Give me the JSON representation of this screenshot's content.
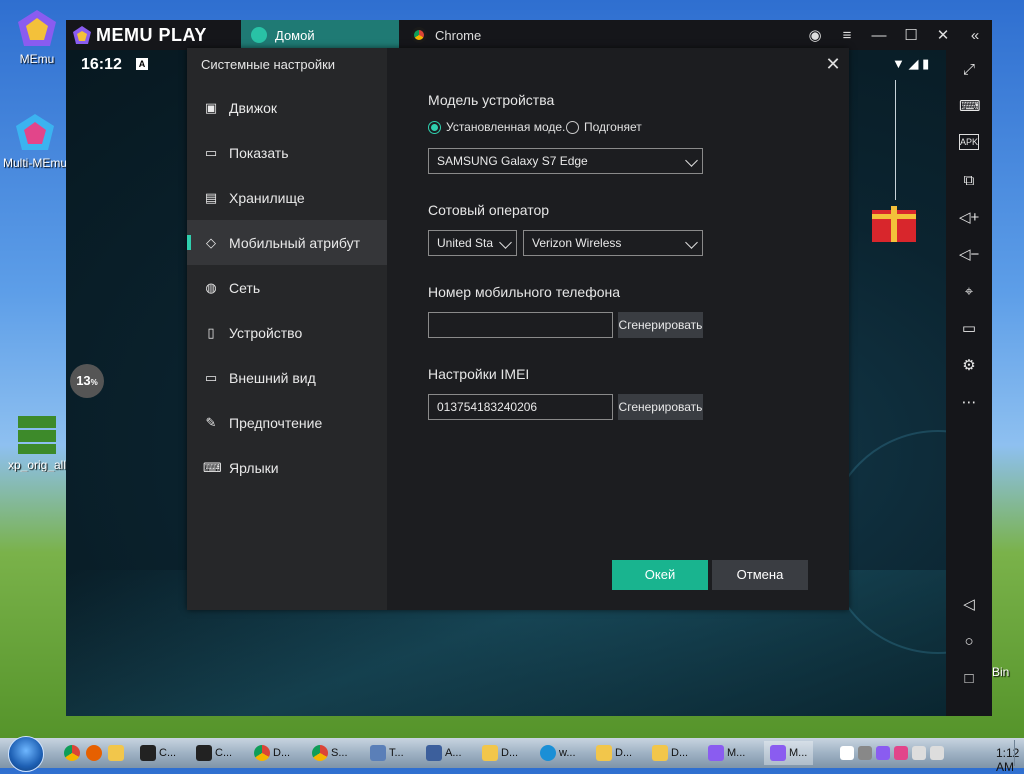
{
  "desktop": {
    "icons": [
      {
        "label": "MEmu"
      },
      {
        "label": "Multi-MEmu"
      },
      {
        "label": "xp_orig_all"
      }
    ],
    "right_label": "Bin"
  },
  "memu": {
    "logo": "MEMU PLAY",
    "tabs": [
      {
        "label": "Домой",
        "active": true
      },
      {
        "label": "Chrome",
        "active": false
      }
    ],
    "window_controls": [
      "account-icon",
      "menu-icon",
      "minimize-icon",
      "maximize-icon",
      "close-icon",
      "collapse-icon"
    ],
    "status_time": "16:12",
    "status_badge": "A",
    "progress_percent": "13",
    "progress_unit": "%"
  },
  "dialog": {
    "title": "Системные настройки",
    "menu": [
      {
        "label": "Движок",
        "icon": "chip-icon"
      },
      {
        "label": "Показать",
        "icon": "monitor-icon"
      },
      {
        "label": "Хранилище",
        "icon": "save-icon"
      },
      {
        "label": "Мобильный атрибут",
        "icon": "tag-icon",
        "active": true
      },
      {
        "label": "Сеть",
        "icon": "globe-icon"
      },
      {
        "label": "Устройство",
        "icon": "phone-icon"
      },
      {
        "label": "Внешний вид",
        "icon": "window-icon"
      },
      {
        "label": "Предпочтение",
        "icon": "wrench-icon"
      },
      {
        "label": "Ярлыки",
        "icon": "keyboard-icon"
      }
    ],
    "device_model": {
      "label": "Модель устройства",
      "radio_installed": "Установленная моде...",
      "radio_custom": "Подгоняет",
      "selected_model": "SAMSUNG Galaxy S7 Edge"
    },
    "carrier": {
      "label": "Сотовый оператор",
      "country": "United Sta",
      "operator": "Verizon Wireless"
    },
    "phone": {
      "label": "Номер мобильного телефона",
      "value": "",
      "generate": "Сгенерировать"
    },
    "imei": {
      "label": "Настройки IMEI",
      "value": "013754183240206",
      "generate": "Сгенерировать"
    },
    "ok": "Окей",
    "cancel": "Отмена"
  },
  "taskbar": {
    "items": [
      {
        "label": "C..."
      },
      {
        "label": "C..."
      },
      {
        "label": "D..."
      },
      {
        "label": "S..."
      },
      {
        "label": "T..."
      },
      {
        "label": "A..."
      },
      {
        "label": "D..."
      },
      {
        "label": "w..."
      },
      {
        "label": "D..."
      },
      {
        "label": "D..."
      },
      {
        "label": "M..."
      },
      {
        "label": "M..."
      }
    ],
    "clock": "1:12 AM"
  },
  "colors": {
    "accent": "#19b48f",
    "dialog_bg": "#1c1d20",
    "menu_bg": "#262729"
  }
}
